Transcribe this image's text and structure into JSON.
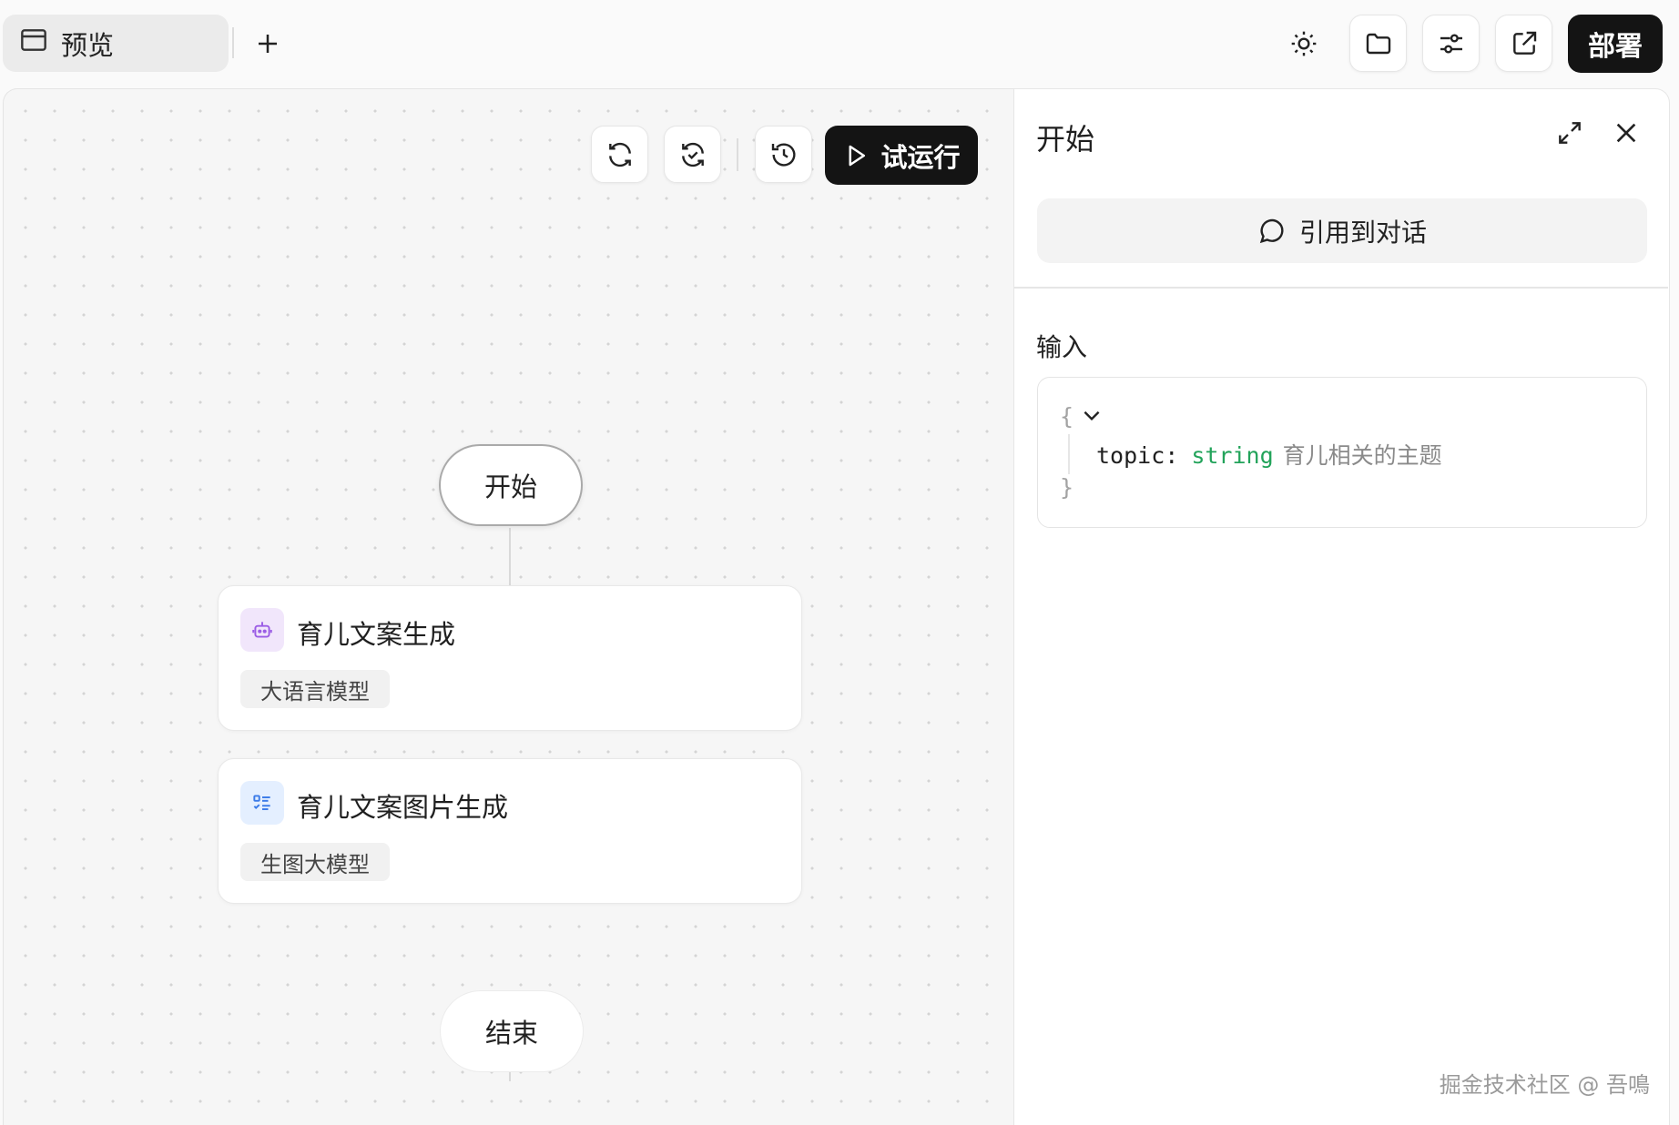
{
  "topbar": {
    "tab_label": "预览",
    "deploy_label": "部署"
  },
  "canvas": {
    "run_label": "试运行",
    "start_node_label": "开始",
    "end_node_label": "结束",
    "nodes": [
      {
        "title": "育儿文案生成",
        "tag": "大语言模型",
        "icon": "robot-icon",
        "icon_bg": "#f1e6fb",
        "icon_color": "#9b5de5"
      },
      {
        "title": "育儿文案图片生成",
        "tag": "生图大模型",
        "icon": "list-check-icon",
        "icon_bg": "#e4efff",
        "icon_color": "#3b7be8"
      }
    ]
  },
  "panel": {
    "title": "开始",
    "ref_button_label": "引用到对话",
    "section_label": "输入",
    "json": {
      "open_brace": "{",
      "close_brace": "}",
      "key": "topic:",
      "type": "string",
      "description": "育儿相关的主题"
    }
  },
  "watermark": "掘金技术社区 @ 吾鳴"
}
